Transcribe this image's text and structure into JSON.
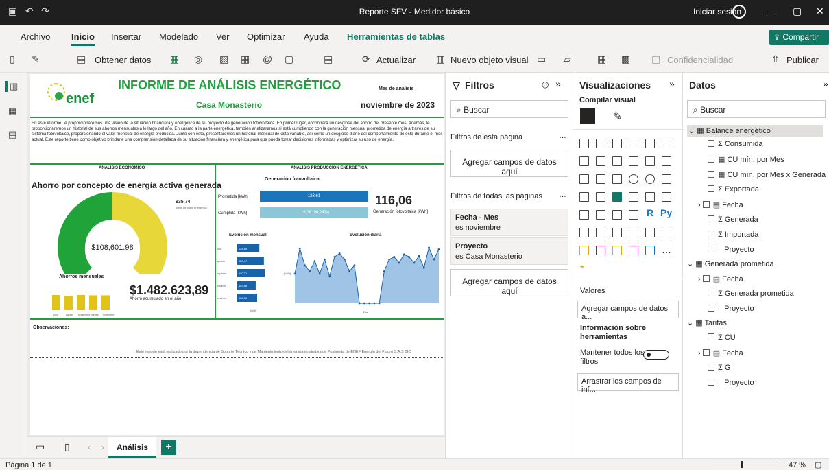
{
  "window": {
    "title": "Reporte SFV - Medidor básico",
    "signin": "Iniciar sesión"
  },
  "ribbon": {
    "tabs": [
      "Archivo",
      "Inicio",
      "Insertar",
      "Modelado",
      "Ver",
      "Optimizar",
      "Ayuda",
      "Herramientas de tablas"
    ],
    "share": "Compartir"
  },
  "toolbar": {
    "get_data": "Obtener datos",
    "refresh": "Actualizar",
    "new_visual": "Nuevo objeto visual",
    "sensitivity": "Confidencialidad",
    "publish": "Publicar"
  },
  "report": {
    "title": "INFORME DE ANÁLISIS ENERGÉTICO",
    "subtitle": "Casa Monasterio",
    "month_label": "Mes de análisis",
    "month_value": "noviembre de 2023",
    "intro": "En este informe, le proporcionaremos una visión de la situación financiera y energética de su proyecto de generación fotovoltaica. En primer lugar, encontrará un desglose del ahorro del presente mes. Además, le proporcionaremos un historial de sus ahorros mensuales a lo largo del año. En cuanto a la parte energética, también analizaremos si está cumpliendo con la generación mensual prometida de energía a través de su sistema fotovoltaico, proporcionando el valor mensual de energía producida. Junto con esto, presentaremos un historial mensual de esta variable, así como un desglose diario del comportamiento de esta durante el mes actual. Este reporte tiene como objetivo brindarle una comprensión detallada de su situación financiera y energética para que pueda tomar decisiones informadas y optimizar su uso de energía.",
    "econ_header": "ANÁLISIS ECONÓMICO",
    "prod_header": "ANÁLISIS PRODUCCIÓN ENERGÉTICA",
    "savings_title": "Ahorro por concepto de energía activa generada",
    "gauge_value": "$108,601.98",
    "tariff_value": "935,74",
    "tariff_label": "Tarifa de costo energético",
    "monthly_savings_title": "Ahorros mensuales",
    "annual_savings": "$1.482.623,89",
    "annual_savings_label": "Ahorro acumulado en el año",
    "gen_title": "Generación fotovoltaica",
    "promised_label": "Prometida [kWh]",
    "promised_value": "128,61",
    "met_label": "Cumplida [kWh]",
    "met_value": "116,06 (90,24%)",
    "gen_big": "116,06",
    "gen_big_label": "Generación fotovoltaica [kWh]",
    "monthly_evo_title": "Evolución mensual",
    "daily_evo_title": "Evolución diaria",
    "observations": "Observaciones:",
    "footer": "Este reporte está realizado por la dependencia de Soporte Técnico y de Mantenimiento del área administrativa de Postventa de ENEF Energía del Futuro S.A.S BIC",
    "logo_text": "enef"
  },
  "chart_data": [
    {
      "type": "pie",
      "title": "Ahorro por concepto de energía activa generada",
      "values": [
        108601.98,
        65000
      ],
      "note": "gauge"
    },
    {
      "type": "bar",
      "title": "Ahorros mensuales",
      "categories": [
        "julio",
        "agosto",
        "septiembre",
        "octubre",
        "noviembre"
      ],
      "values": [
        110,
        105,
        110,
        108,
        108
      ],
      "ylim": [
        0,
        200
      ]
    },
    {
      "type": "bar",
      "title": "Evolución mensual",
      "categories": [
        "julio",
        "agosto",
        "septiem...",
        "octubre",
        "noviem..."
      ],
      "values": [
        128.85,
        155.47,
        160.31,
        107.86,
        116.06
      ],
      "xlabel": "[kWh]",
      "xlim": [
        0,
        200
      ]
    },
    {
      "type": "area",
      "title": "Evolución diaria",
      "x": [
        1,
        2,
        3,
        4,
        5,
        6,
        7,
        8,
        9,
        10,
        11,
        12,
        13,
        14,
        15,
        16,
        17,
        18,
        19,
        20,
        21,
        22,
        23,
        24,
        25,
        26,
        27,
        28,
        29,
        30
      ],
      "values": [
        3.5,
        6.5,
        4.5,
        3.8,
        5,
        3.5,
        5.2,
        3.2,
        5.5,
        5.9,
        5.2,
        3.8,
        4.5,
        0,
        0,
        0,
        0,
        0,
        3.8,
        5.2,
        5.5,
        4.8,
        5.8,
        5.5,
        4.8,
        5.6,
        4.2,
        6.6,
        5.2,
        6.4
      ],
      "xlabel": "Día",
      "ylabel": "[kWh]",
      "ylim": [
        0,
        7
      ]
    }
  ],
  "filters": {
    "title": "Filtros",
    "search": "Buscar",
    "page_filters": "Filtros de esta página",
    "drop_here": "Agregar campos de datos aquí",
    "all_pages": "Filtros de todas las páginas",
    "f1_name": "Fecha - Mes",
    "f1_value": "es noviembre",
    "f2_name": "Proyecto",
    "f2_value": "es Casa Monasterio"
  },
  "viz": {
    "title": "Visualizaciones",
    "build": "Compilar visual",
    "values": "Valores",
    "add_fields": "Agregar campos de datos a...",
    "tooltips": "Información sobre herramientas",
    "keep_filters": "Mantener todos los filtros",
    "drag_fields": "Arrastrar los campos de inf..."
  },
  "data": {
    "title": "Datos",
    "search": "Buscar",
    "fields": [
      "Balance energético",
      "Σ Consumida",
      "▦ CU mín. por Mes",
      "▦ CU mín. por Mes x Generada",
      "Σ Exportada",
      "▤ Fecha",
      "Σ Generada",
      "Σ Importada",
      "Proyecto",
      "Generada prometida",
      "▤ Fecha",
      "Σ Generada prometida",
      "Proyecto",
      "Tarifas",
      "Σ CU",
      "▤ Fecha",
      "Σ G",
      "Proyecto"
    ]
  },
  "pages": {
    "tab": "Análisis",
    "add": "+"
  },
  "status": {
    "page": "Página 1 de 1",
    "zoom": "47 %"
  }
}
